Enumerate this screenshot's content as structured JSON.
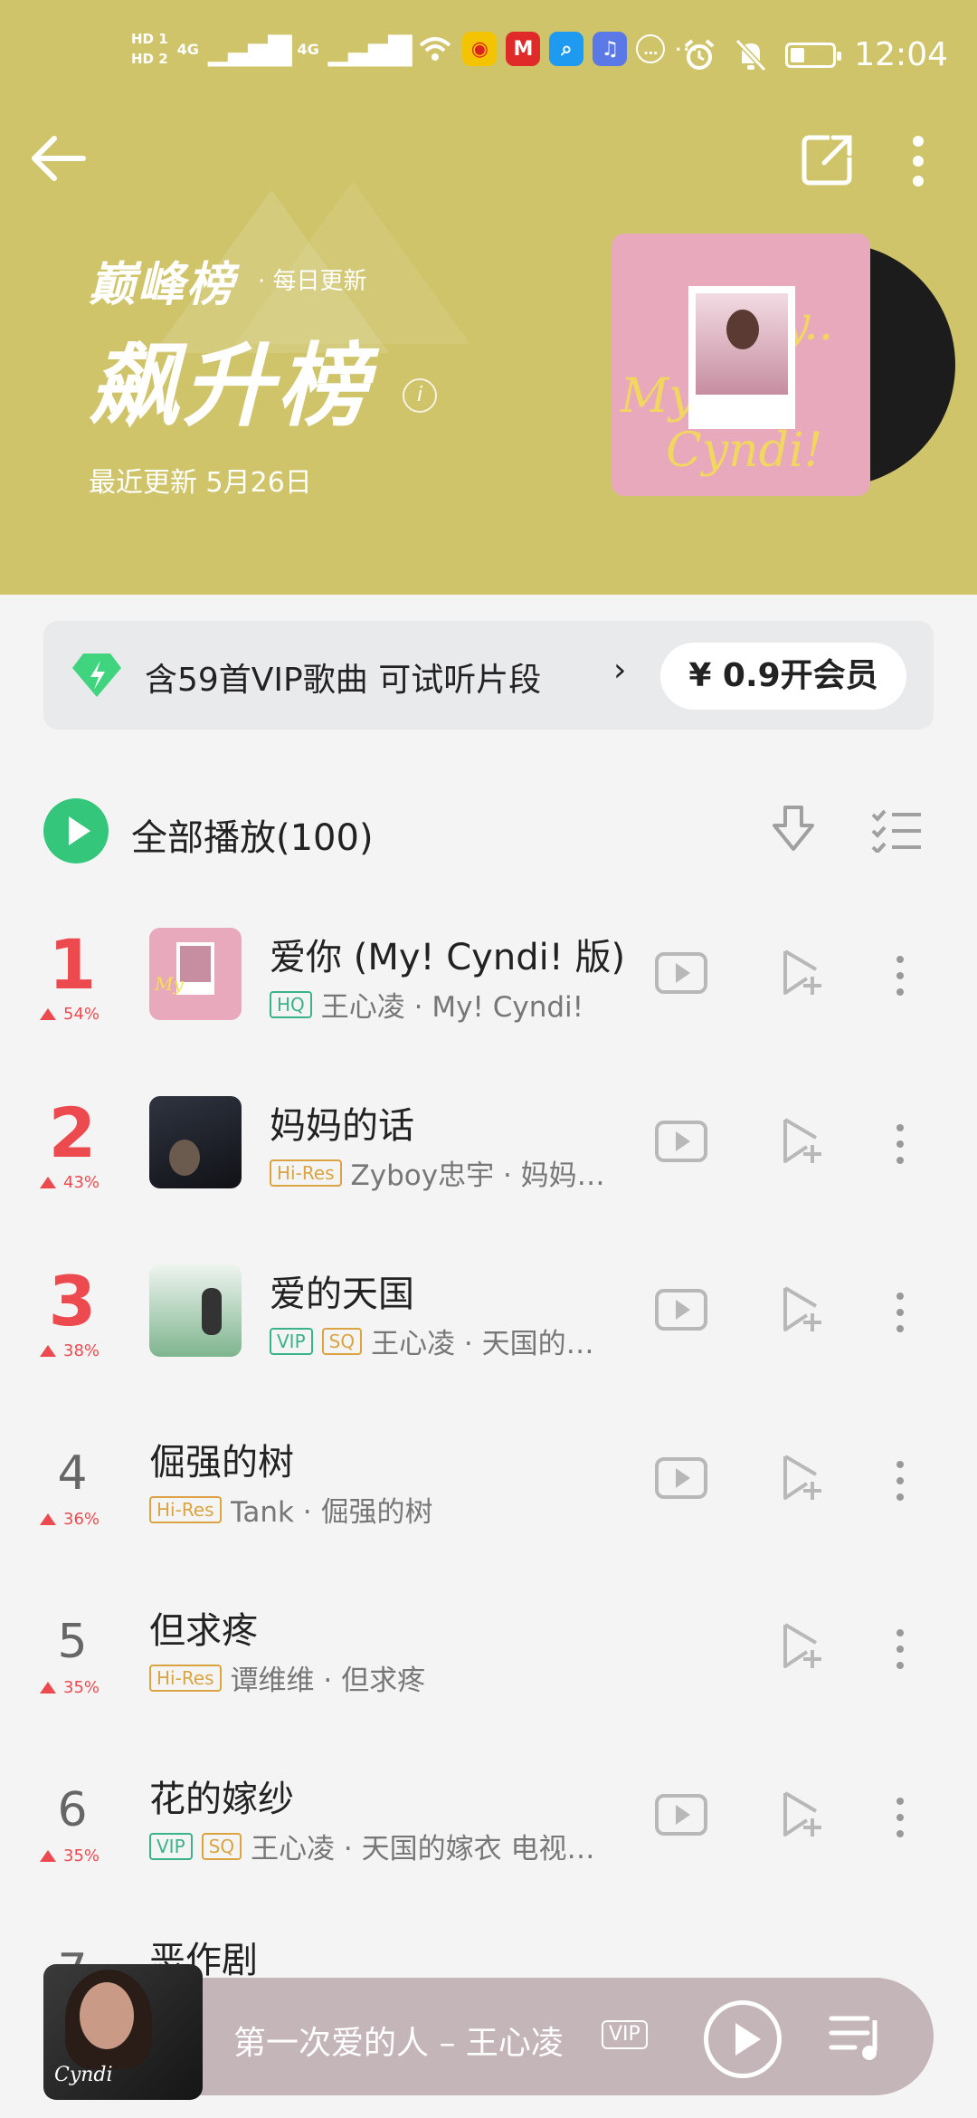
{
  "status_bar": {
    "hd1": "HD 1",
    "hd2": "HD 2",
    "net1": "4G",
    "net2": "4G",
    "app_icons": [
      "weibo-icon",
      "gmail-icon",
      "search-app-icon",
      "music-app-icon",
      "chat-icon"
    ],
    "more": "···",
    "time": "12:04"
  },
  "header": {
    "chart_family": "巅峰榜",
    "update_frequency": "· 每日更新",
    "chart_name": "飙升榜",
    "info_glyph": "i",
    "last_updated": "最近更新 5月26日",
    "accent_color": "#cfc46a"
  },
  "vip_banner": {
    "text": "含59首VIP歌曲 可试听片段",
    "arrow": "›",
    "button_label": "¥ 0.9开会员"
  },
  "play_all": {
    "label": "全部播放(100)"
  },
  "songs": [
    {
      "rank": "1",
      "trend": "54%",
      "title": "爱你 (My! Cyndi! 版)",
      "tags": [
        "HQ"
      ],
      "meta": "王心凌 · My! Cyndi!",
      "has_mv": true,
      "has_thumb": true
    },
    {
      "rank": "2",
      "trend": "43%",
      "title": "妈妈的话",
      "tags": [
        "Hi-Res"
      ],
      "meta": "Zyboy忠宇 · 妈妈…",
      "has_mv": true,
      "has_thumb": true
    },
    {
      "rank": "3",
      "trend": "38%",
      "title": "爱的天国",
      "tags": [
        "VIP",
        "SQ"
      ],
      "meta": "王心凌 · 天国的…",
      "has_mv": true,
      "has_thumb": true
    },
    {
      "rank": "4",
      "trend": "36%",
      "title": "倔强的树",
      "tags": [
        "Hi-Res"
      ],
      "meta": "Tank · 倔强的树",
      "has_mv": true,
      "has_thumb": false
    },
    {
      "rank": "5",
      "trend": "35%",
      "title": "但求疼",
      "tags": [
        "Hi-Res"
      ],
      "meta": "谭维维 · 但求疼",
      "has_mv": false,
      "has_thumb": false
    },
    {
      "rank": "6",
      "trend": "35%",
      "title": "花的嫁纱",
      "tags": [
        "VIP",
        "SQ"
      ],
      "meta": "王心凌 · 天国的嫁衣 电视…",
      "has_mv": true,
      "has_thumb": false
    },
    {
      "rank": "7",
      "trend": "",
      "title": "恶作剧",
      "tags": [],
      "meta": "",
      "has_mv": false,
      "has_thumb": false
    }
  ],
  "mini_player": {
    "now_playing": "第一次爱的人 – 王心凌",
    "badge": "VIP",
    "cover_logo": "Cyndi"
  },
  "colors": {
    "rank_red": "#ec4a4f",
    "play_green": "#34c77b",
    "tag_green": "#3ab389",
    "tag_gold": "#d9a441"
  }
}
